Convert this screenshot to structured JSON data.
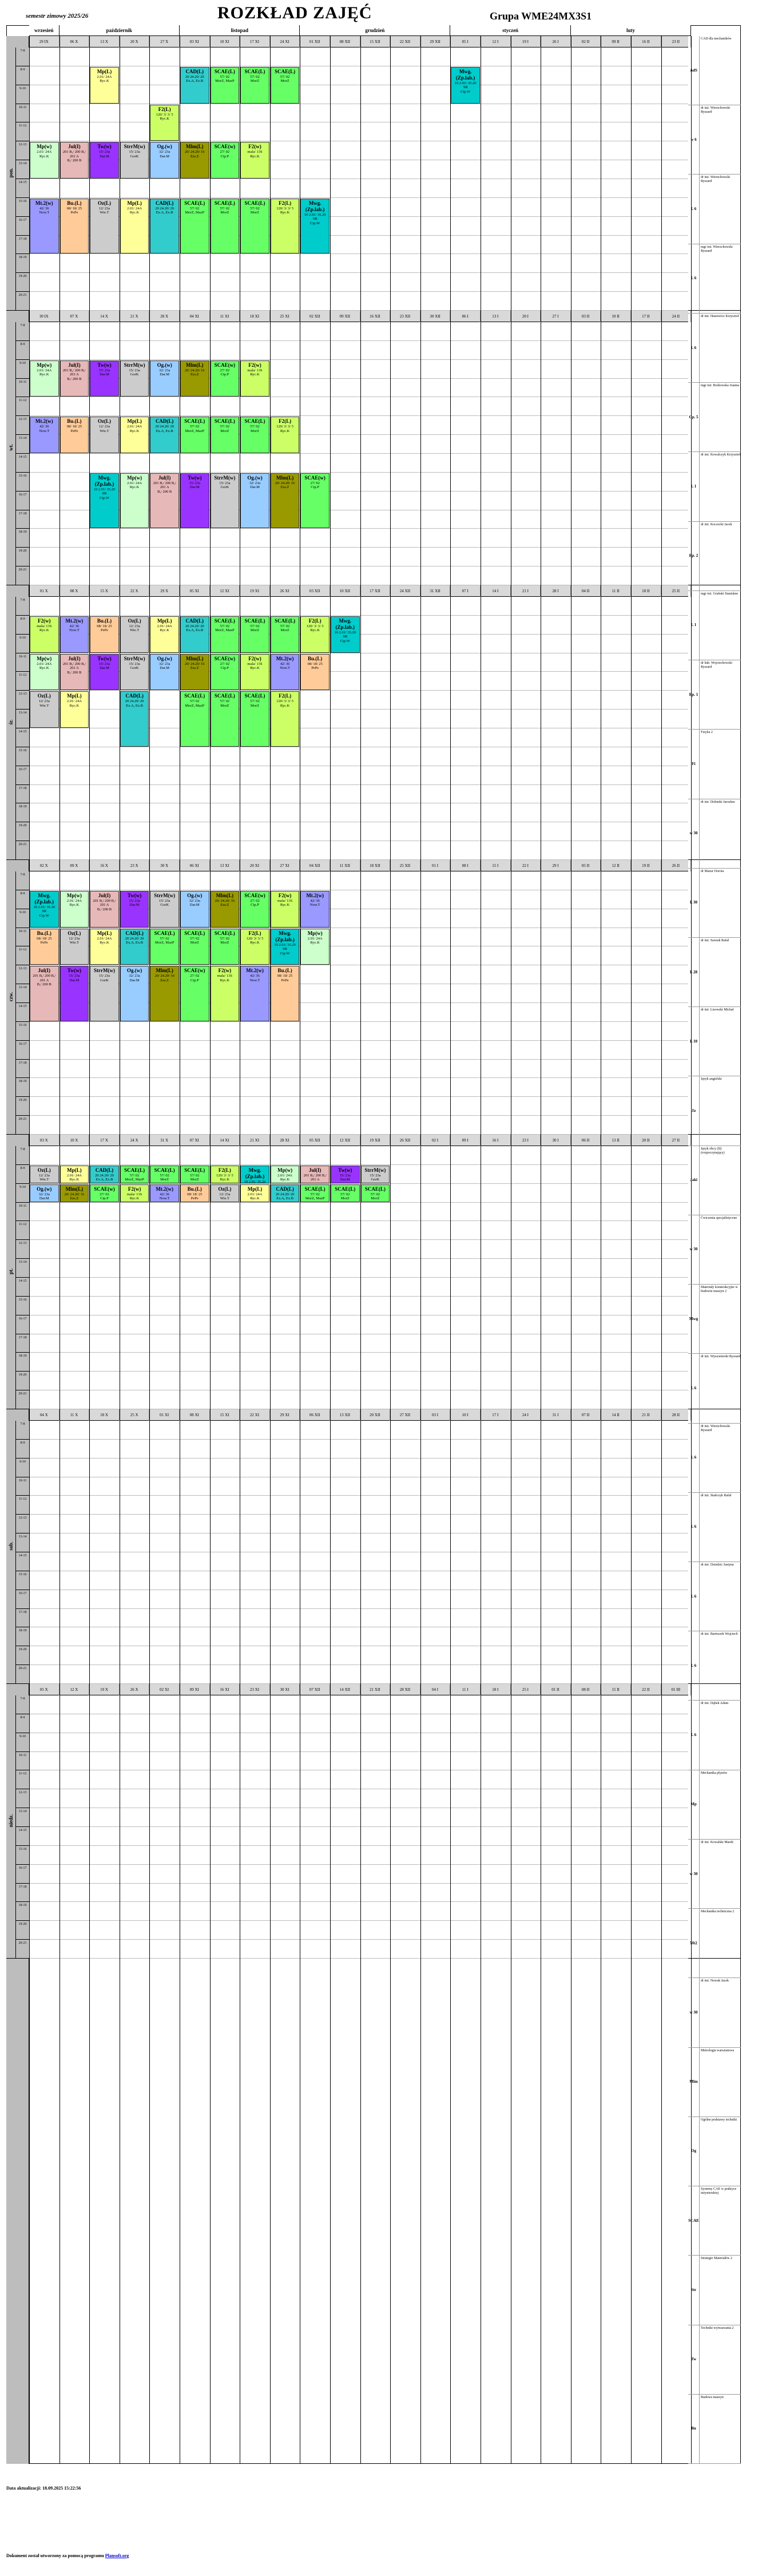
{
  "header": {
    "semester": "semestr zimowy 2025/26",
    "title": "ROZKŁAD ZAJĘĆ",
    "group": "Grupa WME24MX3S1"
  },
  "months": [
    "wrzesień",
    "październik",
    "listopad",
    "grudzień",
    "styczeń",
    "luty"
  ],
  "days": [
    "pon.",
    "wt.",
    "śr.",
    "czw.",
    "pt.",
    "sob.",
    "niedz."
  ],
  "hours": [
    "7-8",
    "8-9",
    "9-10",
    "10-11",
    "11-12",
    "12-13",
    "13-14",
    "14-15",
    "15-16",
    "16-17",
    "17-18",
    "18-19",
    "19-20",
    "20-21"
  ],
  "week_dates": {
    "mon": [
      "29 IX",
      "06 X",
      "13 X",
      "20 X",
      "27 X",
      "03 XI",
      "10 XI",
      "17 XI",
      "24 XI",
      "01 XII",
      "08 XII",
      "15 XII",
      "22 XII",
      "29 XII",
      "05 I",
      "12 I",
      "19 I",
      "26 I",
      "02 II",
      "09 II",
      "16 II",
      "23 II"
    ],
    "tue": [
      "30 IX",
      "07 X",
      "14 X",
      "21 X",
      "28 X",
      "04 XI",
      "11 XI",
      "18 XI",
      "25 XI",
      "02 XII",
      "09 XII",
      "16 XII",
      "23 XII",
      "30 XII",
      "06 I",
      "13 I",
      "20 I",
      "27 I",
      "03 II",
      "10 II",
      "17 II",
      "24 II"
    ],
    "wed": [
      "01 X",
      "08 X",
      "15 X",
      "22 X",
      "29 X",
      "05 XI",
      "12 XI",
      "19 XI",
      "26 XI",
      "03 XII",
      "10 XII",
      "17 XII",
      "24 XII",
      "31 XII",
      "07 I",
      "14 I",
      "21 I",
      "28 I",
      "04 II",
      "11 II",
      "18 II",
      "25 II"
    ],
    "thu": [
      "02 X",
      "09 X",
      "16 X",
      "23 X",
      "30 X",
      "06 XI",
      "13 XI",
      "20 XI",
      "27 XI",
      "04 XII",
      "11 XII",
      "18 XII",
      "25 XII",
      "01 I",
      "08 I",
      "15 I",
      "22 I",
      "29 I",
      "05 II",
      "12 II",
      "19 II",
      "26 II"
    ],
    "fri": [
      "03 X",
      "10 X",
      "17 X",
      "24 X",
      "31 X",
      "07 XI",
      "14 XI",
      "21 XI",
      "28 XI",
      "05 XII",
      "12 XII",
      "19 XII",
      "26 XII",
      "02 I",
      "09 I",
      "16 I",
      "23 I",
      "30 I",
      "06 II",
      "13 II",
      "20 II",
      "27 II"
    ],
    "sat": [
      "04 X",
      "11 X",
      "18 X",
      "25 X",
      "01 XI",
      "08 XI",
      "15 XI",
      "22 XI",
      "29 XI",
      "06 XII",
      "13 XII",
      "20 XII",
      "27 XII",
      "03 I",
      "10 I",
      "17 I",
      "24 I",
      "31 I",
      "07 II",
      "14 II",
      "21 II",
      "28 II"
    ],
    "sun": [
      "05 X",
      "12 X",
      "19 X",
      "26 X",
      "02 XI",
      "09 XI",
      "16 XI",
      "23 XI",
      "30 XI",
      "07 XII",
      "14 XII",
      "21 XII",
      "28 XII",
      "04 I",
      "11 I",
      "18 I",
      "25 I",
      "01 II",
      "08 II",
      "15 II",
      "22 II",
      "01 III"
    ]
  },
  "classes": [
    {
      "code": "Mp(L)",
      "info": "2.01/ 24A",
      "room": "Ryc.K",
      "color": "#ffff99"
    },
    {
      "code": "CAD(L)",
      "info": "20 24.20/ 20",
      "room": "Ex.A, Ex.B",
      "color": "#33cccc"
    },
    {
      "code": "SCAE(L)",
      "info": "57/ 02",
      "room": "MorZ, MazP",
      "color": "#66ff66"
    },
    {
      "code": "SCAE(L)",
      "info": "57/ 02",
      "room": "MorZ",
      "color": "#66ff66"
    },
    {
      "code": "SCAE(L)",
      "info": "57/ 02",
      "room": "MorZ",
      "color": "#66ff66"
    },
    {
      "code": "F2(L)",
      "info": "120/ 3/ 3/ 5",
      "room": "Ryc.K",
      "color": "#ccff66"
    },
    {
      "code": "Mwg.(Zp.lab.)",
      "info": "10 2.01/ 35.20 SR",
      "room": "Cip.W",
      "color": "#00cccc"
    },
    {
      "code": "Mp(w)",
      "info": "2.01/ 24A",
      "room": "Ryc.K",
      "color": "#ccffcc"
    },
    {
      "code": "Jul(I)",
      "info": "201 B,/ 200 B,/ 201 A",
      "room": "B,/ 200 B",
      "color": "#e6b8b7"
    },
    {
      "code": "Tw(w)",
      "info": "15/ 23a",
      "room": "Dar.M",
      "color": "#9933ff"
    },
    {
      "code": "StrrM(w)",
      "info": "15/ 23a",
      "room": "GorK",
      "color": "#cccccc"
    },
    {
      "code": "Og.(w)",
      "info": "32/ 23a",
      "room": "Dar.M",
      "color": "#99ccff"
    },
    {
      "code": "Mlm(L)",
      "info": "20/ 24.20/ 16",
      "room": "Ess.Z",
      "color": "#999900"
    },
    {
      "code": "SCAE(w)",
      "info": "27/ 02",
      "room": "Cip.P",
      "color": "#66ff66"
    },
    {
      "code": "F2(w)",
      "info": "mala/ 13S",
      "room": "Ryc.K",
      "color": "#ccff66"
    },
    {
      "code": "Mt.2(w)",
      "info": "42/ 36",
      "room": "Now.T",
      "color": "#9999ff"
    },
    {
      "code": "Bu.(L)",
      "info": "08/ 18/ 25",
      "room": "PePe",
      "color": "#ffcc99"
    },
    {
      "code": "Oz(L)",
      "info": "12/ 23a",
      "room": "Wie.T",
      "color": "#cccccc"
    }
  ],
  "legend": [
    {
      "code": "AdS",
      "name": "CAD dla mechaników"
    },
    {
      "code": "w 6",
      "name": "dr inż. Wierzchowski Ryszard"
    },
    {
      "code": "L 6",
      "name": "dr inż. Wierzchowski Ryszard"
    },
    {
      "code": "L 6",
      "name": "mgr inż. Wierzchowski Ryszard"
    },
    {
      "code": "L 6",
      "name": "dr inż. Hasiewicz Krzysztof"
    },
    {
      "code": "Cp. 5",
      "name": "mgr inż. Borkowska Joanna"
    },
    {
      "code": "L 1",
      "name": "dr inż. Kowalczyk Krzysztof"
    },
    {
      "code": "Ep. 2",
      "name": "dr inż. Koczocki Jacek"
    },
    {
      "code": "L 1",
      "name": "mgr inż. Grabski Stanisław"
    },
    {
      "code": "Ep. 1",
      "name": "dr hab. Wojciechowski Ryszard"
    },
    {
      "code": "Fi",
      "name": "Fizyka 2"
    },
    {
      "code": "w 30",
      "name": "dr inż. Dolinski Jarosław"
    },
    {
      "code": "L 30",
      "name": "dr Mazur Dorota"
    },
    {
      "code": "L 28",
      "name": "dr inż. Sawiak Rafał"
    },
    {
      "code": "L 10",
      "name": "dr inż. Lisowski Michał"
    },
    {
      "code": "Ja",
      "name": "Język angielski"
    },
    {
      "code": "Jaki",
      "name": "Język obcy (II) (rozpoczynający)"
    },
    {
      "code": "w 30",
      "name": "Ćwiczenia specjalistyczne"
    },
    {
      "code": "Mwg",
      "name": "Materiały konstrukcyjne w budowie maszyn 2"
    },
    {
      "code": "L 6",
      "name": "dr inż. Wyszomirski Ryszard"
    },
    {
      "code": "L 6",
      "name": "dr inż. Wierzchowski Ryszard"
    },
    {
      "code": "L 6",
      "name": "dr inż. Stańczyk Rafał"
    },
    {
      "code": "L 6",
      "name": "dr inż. Dziedzic Justyna"
    },
    {
      "code": "L 6",
      "name": "dr inż. Bartoszek Wojciech"
    },
    {
      "code": "L 6",
      "name": "dr inż. Dąbek Adam"
    },
    {
      "code": "Mp",
      "name": "Mechanika płynów"
    },
    {
      "code": "w 30",
      "name": "dr inż. Kowalski Marek"
    },
    {
      "code": "Mt2",
      "name": "Mechanika techniczna 2"
    },
    {
      "code": "w 30",
      "name": "dr inż. Nowak Jacek"
    },
    {
      "code": "Mlm",
      "name": "Metrologia warsztatowa"
    },
    {
      "code": "Og",
      "name": "Ogólne podstawy techniki"
    },
    {
      "code": "SCAE",
      "name": "Systemy CAE w praktyce inżynierskiej"
    },
    {
      "code": "Str",
      "name": "Strategie Materiałów 2"
    },
    {
      "code": "Tw",
      "name": "Techniki wytwarzania 2"
    },
    {
      "code": "Bu",
      "name": "Budowa maszyn"
    }
  ],
  "footer": {
    "updated": "Data aktualizacji: 18.09.2025 15:22:56",
    "generated_prefix": "Dokument został utworzony za pomocą programu",
    "generated_link": "Plansoft.org"
  }
}
